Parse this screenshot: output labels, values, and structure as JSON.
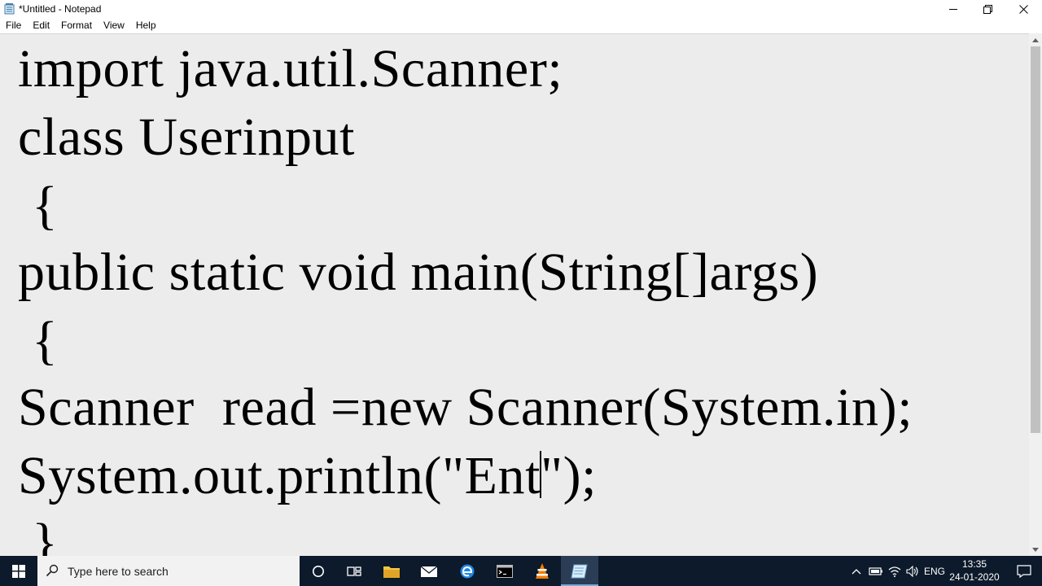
{
  "window": {
    "title": "*Untitled - Notepad",
    "buttons": {
      "minimize": "minimize",
      "restore": "restore",
      "close": "close"
    }
  },
  "menu": [
    "File",
    "Edit",
    "Format",
    "View",
    "Help"
  ],
  "editor": {
    "lines": [
      "import java.util.Scanner;",
      "class Userinput",
      " {",
      "public static void main(String[]args)",
      " {",
      "Scanner  read =new Scanner(System.in);",
      "System.out.println(\"Ent",
      " }"
    ],
    "line7_after_caret": "\");"
  },
  "taskbar": {
    "search_placeholder": "Type here to search",
    "apps": [
      "cortana-icon",
      "task-view-icon",
      "file-explorer-icon",
      "mail-icon",
      "edge-icon",
      "command-prompt-icon",
      "vlc-icon",
      "notepad-icon"
    ],
    "language": "ENG",
    "time": "13:35",
    "date": "24-01-2020"
  },
  "colors": {
    "taskbar_bg": "#0c1a2b",
    "editor_bg": "#ececec",
    "active_app_bg": "#2b3d55"
  }
}
